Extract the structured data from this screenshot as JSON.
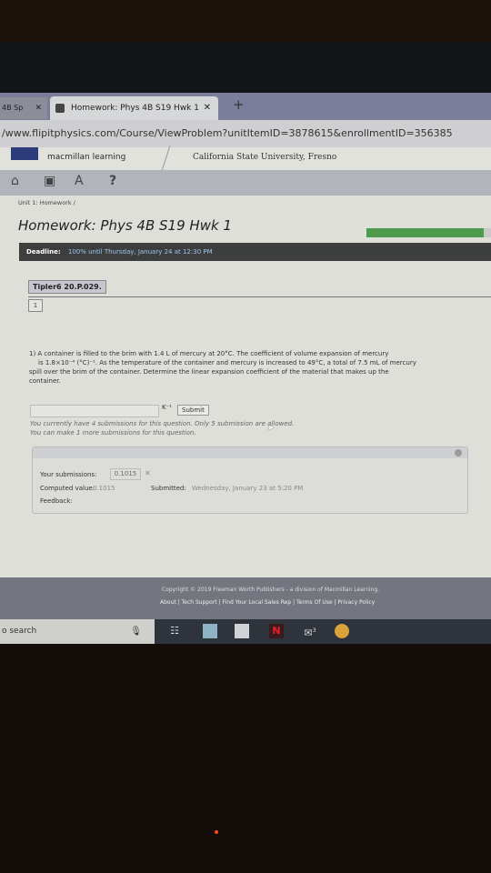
{
  "browser": {
    "tabs": [
      {
        "label": "4B Sp",
        "active": false
      },
      {
        "label": "Homework: Phys 4B S19 Hwk 1",
        "active": true
      }
    ],
    "url": "/www.flipitphysics.com/Course/ViewProblem?unitItemID=3878615&enrollmentID=356385"
  },
  "header": {
    "brand": "macmillan learning",
    "university": "California State University, Fresno",
    "icons": [
      "home-icon",
      "calendar-icon",
      "gradebook-icon",
      "help-icon"
    ]
  },
  "breadcrumb": "Unit 1: Homework /",
  "homework": {
    "title": "Homework: Phys 4B S19 Hwk 1",
    "progress_fraction": 0.94,
    "deadline_label": "Deadline:",
    "deadline_value": "100% until Thursday, January 24 at 12:30 PM"
  },
  "problem": {
    "tab_label": "Tipler6 20.P.029.",
    "page_number": "1",
    "question_line1": "1) A container is filled to the brim with 1.4 L of mercury at 20°C. The coefficient of volume expansion of mercury",
    "question_line2": "is 1.8×10⁻⁴ (°C)⁻¹. As the temperature of the container and mercury is increased to 49°C, a total of 7.5 mL of mercury",
    "question_line3": "spill over the brim of the container. Determine the linear expansion coefficient of the material that makes up the",
    "question_line4": "container.",
    "answer_value": "",
    "unit": "K⁻¹",
    "submit_label": "Submit",
    "note_line1": "You currently have 4 submissions for this question. Only 5 submission are allowed.",
    "note_line2": "You can make 1 more submissions for this question."
  },
  "submissions": {
    "your_label": "Your submissions:",
    "your_value": "0.1015",
    "computed_label": "Computed value:",
    "computed_value": "0.1015",
    "submitted_label": "Submitted:",
    "submitted_value": "Wednesday, January 23 at 5:20 PM",
    "feedback_label": "Feedback:"
  },
  "footer": {
    "copyright": "Copyright © 2019 Freeman Worth Publishers - a division of Macmillan Learning.",
    "links": [
      "About",
      "Tech Support",
      "Find Your Local Sales Rep",
      "Terms Of Use",
      "Privacy Policy"
    ]
  },
  "taskbar": {
    "search_placeholder": "o search",
    "mail_badge": "3"
  },
  "colors": {
    "progress": "#4e9a4f",
    "deadline_bar": "#3d3e3e",
    "footer": "#73767e"
  }
}
